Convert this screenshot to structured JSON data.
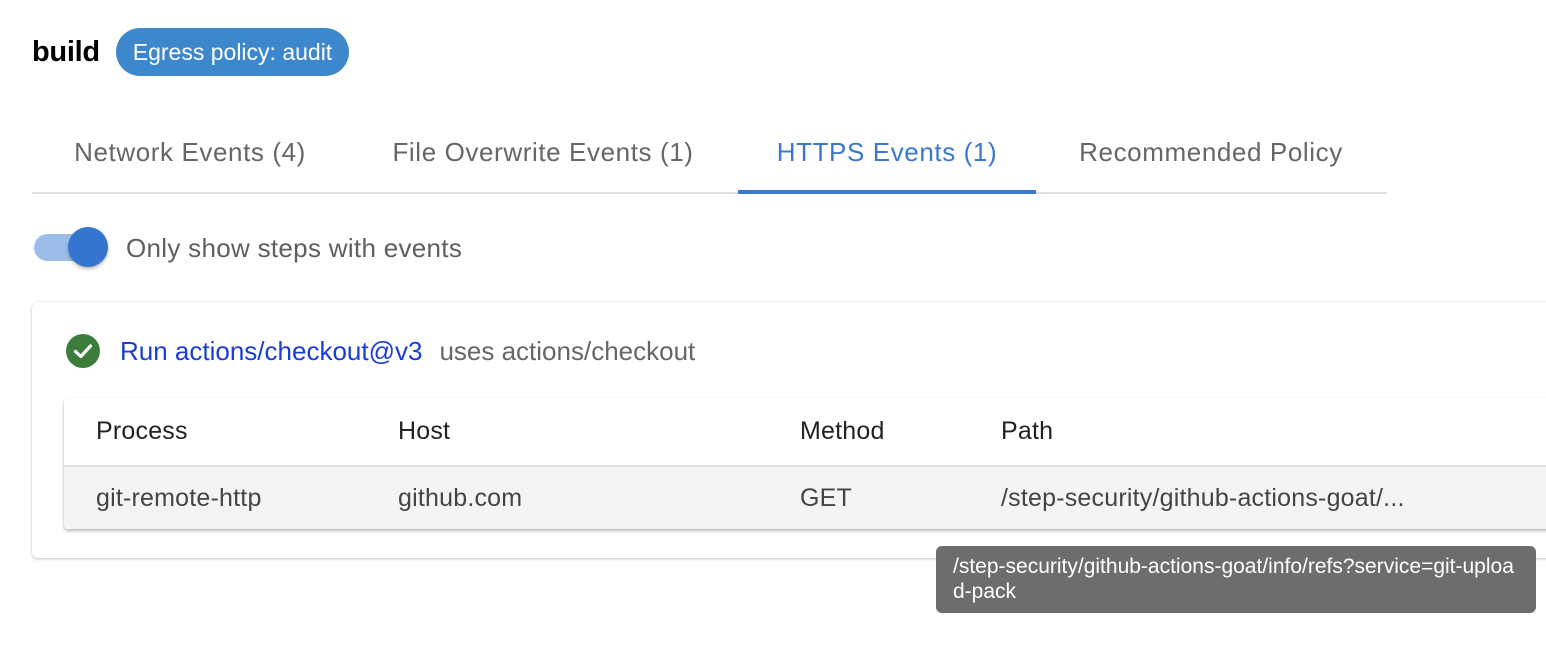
{
  "header": {
    "job_name": "build",
    "policy_chip": "Egress policy: audit"
  },
  "tabs": [
    {
      "label": "Network Events (4)",
      "active": false
    },
    {
      "label": "File Overwrite Events (1)",
      "active": false
    },
    {
      "label": "HTTPS Events (1)",
      "active": true
    },
    {
      "label": "Recommended Policy",
      "active": false
    }
  ],
  "toggle": {
    "label": "Only show steps with events",
    "checked": true
  },
  "step": {
    "status_icon": "check-circle-icon",
    "status": "success",
    "name": "Run actions/checkout@v3",
    "uses": "uses actions/checkout"
  },
  "table": {
    "columns": [
      "Process",
      "Host",
      "Method",
      "Path"
    ],
    "rows": [
      {
        "process": "git-remote-http",
        "host": "github.com",
        "method": "GET",
        "path": "/step-security/github-actions-goat/..."
      }
    ]
  },
  "tooltip": {
    "text": "/step-security/github-actions-goat/info/refs?service=git-upload-pack"
  },
  "colors": {
    "accent": "#3a78cc",
    "chip_bg": "#3d88cc",
    "success": "#3d7d3c",
    "link": "#1a3dd6",
    "tooltip_bg": "#6d6d6d"
  }
}
